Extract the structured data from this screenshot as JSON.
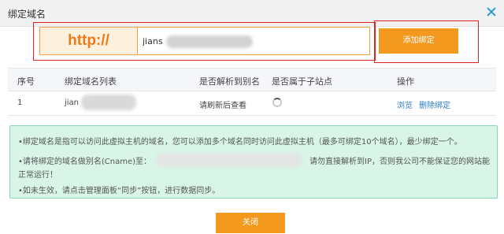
{
  "dialog": {
    "title": "绑定域名"
  },
  "url_bar": {
    "prefix": "http://",
    "value": "jians"
  },
  "add_button": "添加绑定",
  "table": {
    "headers": [
      "序号",
      "绑定域名列表",
      "是否解析到别名",
      "是否属于子站点",
      "操作"
    ],
    "rows": [
      {
        "index": "1",
        "domain": "jian",
        "status": "请刷新后查看",
        "actions": [
          "浏览",
          "删除绑定"
        ]
      }
    ]
  },
  "notice": {
    "line1": "•绑定域名是指可以访问此虚拟主机的域名，您可以添加多个域名同时访问此虚拟主机（最多可绑定10个域名），最少绑定一个。",
    "line2_a": "•请将绑定的域名做别名(Cname)至：",
    "line2_b": "请勿直接解析到IP，否则我公司不能保证您的网站能",
    "line3": "正常运行！",
    "line4": "•如未生效，请点击管理面板“同步”按钮，进行数据同步。"
  },
  "close_button": "关闭",
  "colors": {
    "accent_orange": "#f39a1e",
    "notice_bg": "#d8f5e8",
    "highlight_red": "#dd2222",
    "link_blue": "#2a7cc7"
  }
}
